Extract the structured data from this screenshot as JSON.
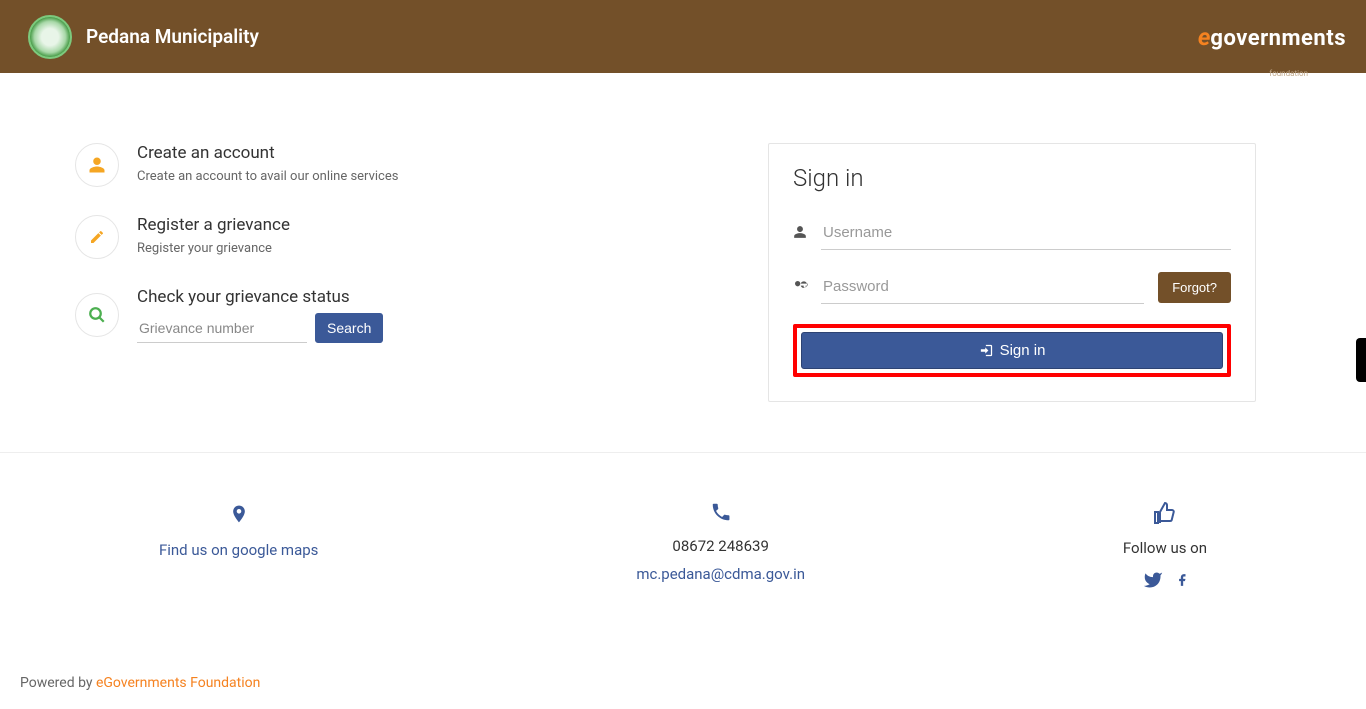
{
  "header": {
    "title": "Pedana Municipality",
    "logo_e": "e",
    "logo_text": "governments",
    "logo_sub": "foundation"
  },
  "services": {
    "create_account": {
      "title": "Create an account",
      "desc": "Create an account to avail our online services"
    },
    "register_grievance": {
      "title": "Register a grievance",
      "desc": "Register your grievance"
    },
    "check_status": {
      "title": "Check your grievance status",
      "placeholder": "Grievance number",
      "button": "Search"
    }
  },
  "signin": {
    "title": "Sign in",
    "username_placeholder": "Username",
    "password_placeholder": "Password",
    "forgot": "Forgot?",
    "button": "Sign in"
  },
  "footer": {
    "maps_link": "Find us on google maps",
    "phone": "08672 248639",
    "email": "mc.pedana@cdma.gov.in",
    "follow": "Follow us on"
  },
  "bottombar": {
    "powered": "Powered by ",
    "link": "eGovernments Foundation"
  }
}
